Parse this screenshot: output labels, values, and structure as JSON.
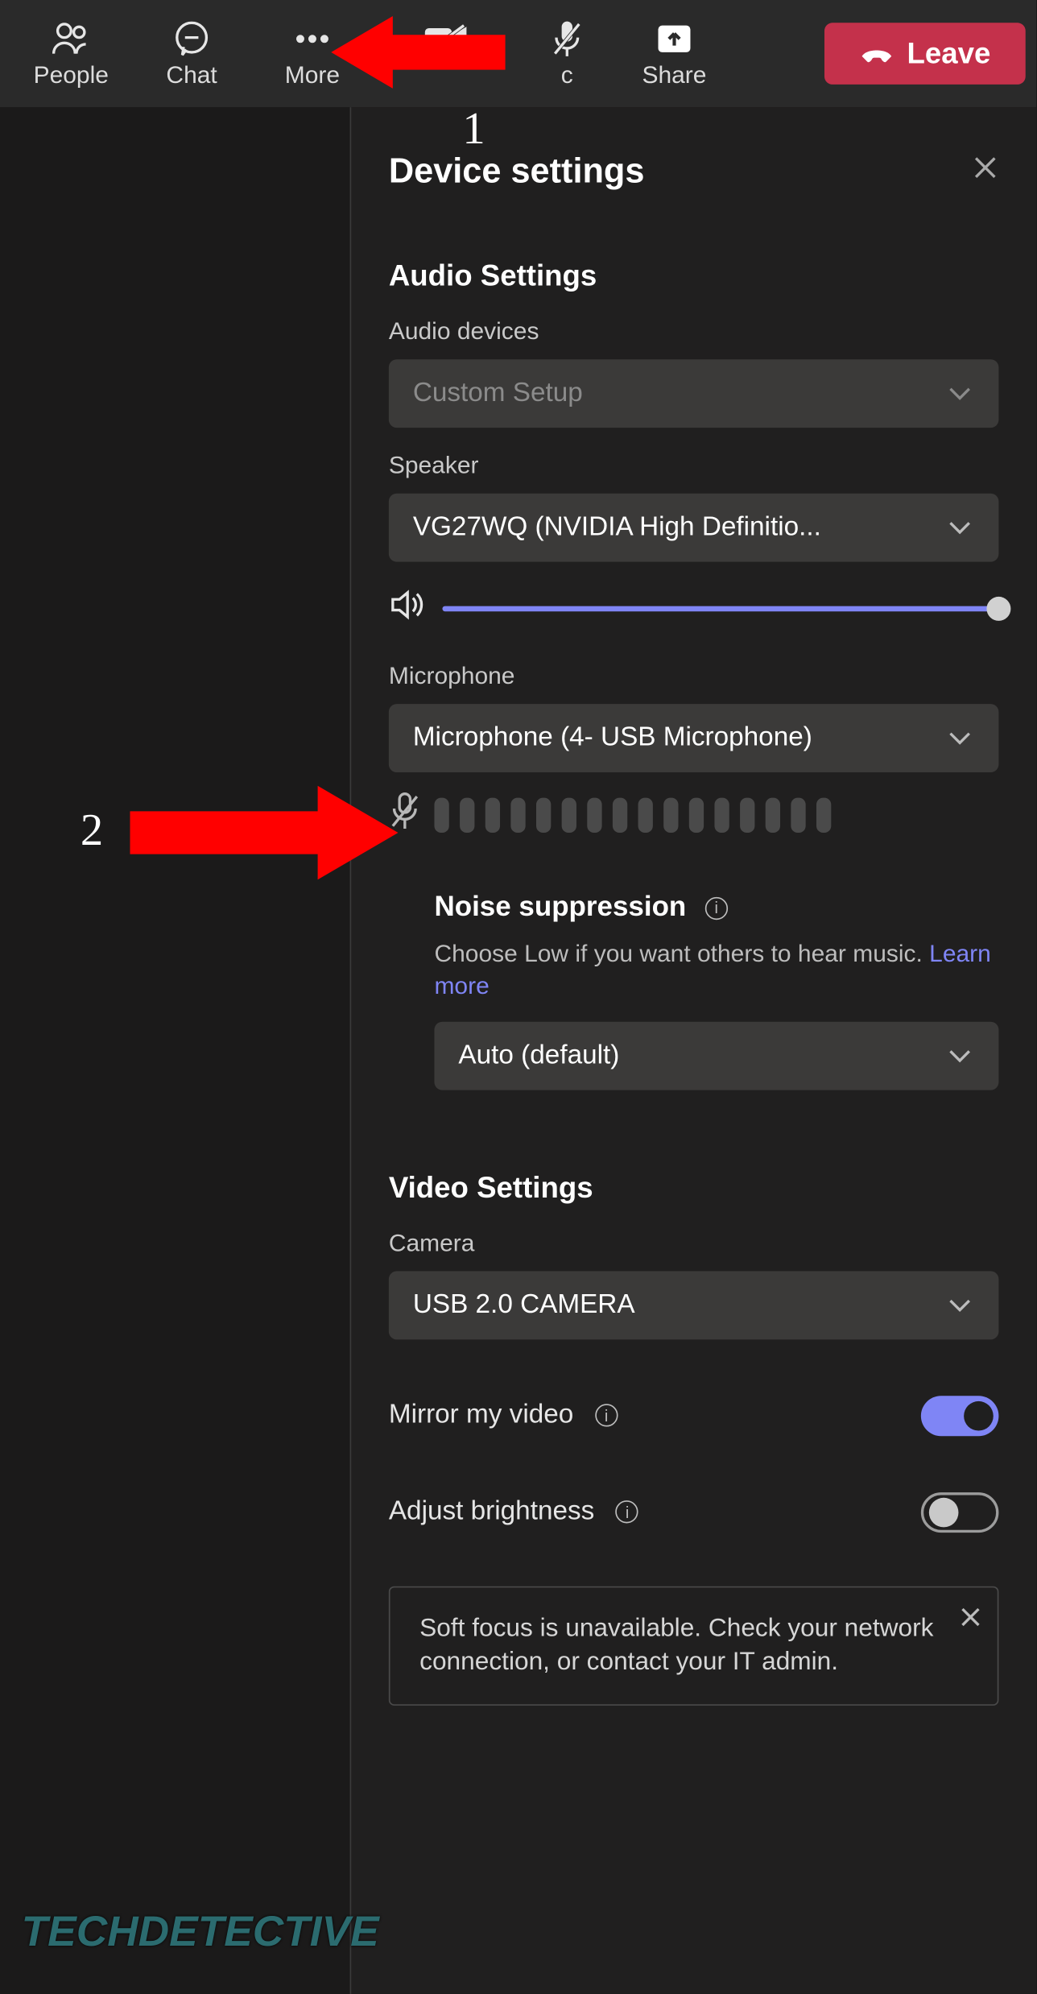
{
  "topbar": {
    "people": "People",
    "chat": "Chat",
    "more": "More",
    "mic_hidden": "c",
    "share": "Share",
    "leave": "Leave"
  },
  "panel": {
    "title": "Device settings",
    "audio": {
      "section_title": "Audio Settings",
      "devices_label": "Audio devices",
      "devices_value": "Custom Setup",
      "speaker_label": "Speaker",
      "speaker_value": "VG27WQ (NVIDIA High Definitio...",
      "mic_label": "Microphone",
      "mic_value": "Microphone (4- USB Microphone)",
      "noise_title": "Noise suppression",
      "noise_desc_prefix": "Choose Low if you want others to hear music. ",
      "noise_link": "Learn more",
      "noise_value": "Auto (default)"
    },
    "video": {
      "section_title": "Video Settings",
      "camera_label": "Camera",
      "camera_value": "USB 2.0 CAMERA",
      "mirror_label": "Mirror my video",
      "brightness_label": "Adjust brightness"
    },
    "alert": "Soft focus is unavailable. Check your network connection, or contact your IT admin."
  },
  "annotations": {
    "one": "1",
    "two": "2"
  },
  "watermark": "TECHDETECTIVE"
}
